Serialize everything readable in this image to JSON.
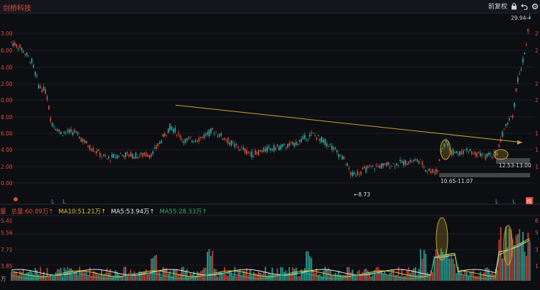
{
  "app": {
    "title": "剑桥科技"
  },
  "toolbar": {
    "adjust_label": "前复权"
  },
  "colors": {
    "up": "#e04b3c",
    "down": "#2bb5a8",
    "trend": "#c8a42a",
    "ma10": "#e0c23a",
    "ma5": "#e8e8e8",
    "ma55": "#29b36b",
    "bg": "#0d0e12"
  },
  "icons": [
    "lock-icon",
    "undo-icon",
    "settings-icon"
  ],
  "price_axis_labels": [
    "3.00",
    "6.00",
    "4.00",
    "2.00",
    "0.00",
    "8.00",
    "6.00",
    "4.00",
    "2.00",
    "0.00"
  ],
  "right_axis_labels": [
    "2",
    "2",
    "2",
    "2",
    "1",
    "1",
    "1"
  ],
  "volume_axis_labels": [
    "5.41",
    "5.56",
    "7.71",
    "3.85",
    "万"
  ],
  "volume_right_labels": [
    "6",
    "5",
    "3",
    "1"
  ],
  "annotations": {
    "high": "29.94",
    "low": "8.73",
    "range1": "12.53-13.00",
    "range2": "10.65-11.07",
    "tag": "税"
  },
  "ma": {
    "vol_prefix": "量",
    "total": "总量:60.89万↑",
    "ma10": "MA10:51.21万↑",
    "ma5": "MA5:53.94万↑",
    "ma55": "MA55:28.33万↑"
  },
  "chart_data": {
    "type": "candlestick",
    "price_range": [
      6.0,
      31.0
    ],
    "trend_line": {
      "from_price": 19.0,
      "to_price": 14.0
    },
    "markers": [
      "L",
      "L",
      "L",
      "L"
    ]
  }
}
